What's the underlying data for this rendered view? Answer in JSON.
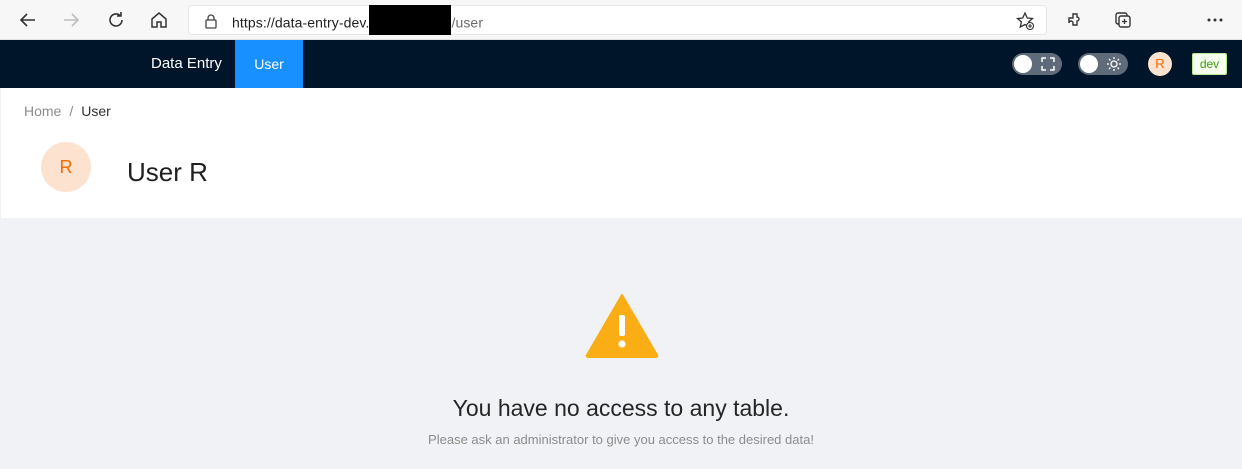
{
  "browser": {
    "url_host": "https://data-entry-dev.",
    "url_path": "/user"
  },
  "header": {
    "brand": "Data Entry",
    "active_tab": "User",
    "avatar_initial": "R",
    "env_tag": "dev"
  },
  "breadcrumb": {
    "home": "Home",
    "separator": "/",
    "current": "User"
  },
  "profile": {
    "avatar_initial": "R",
    "title": "User R"
  },
  "result": {
    "title": "You have no access to any table.",
    "subtitle": "Please ask an administrator to give you access to the desired data!"
  },
  "colors": {
    "header_bg": "#001529",
    "accent": "#1890ff",
    "warning": "#faad14",
    "avatar_bg": "#fde3cf",
    "avatar_fg": "#f56a00"
  }
}
